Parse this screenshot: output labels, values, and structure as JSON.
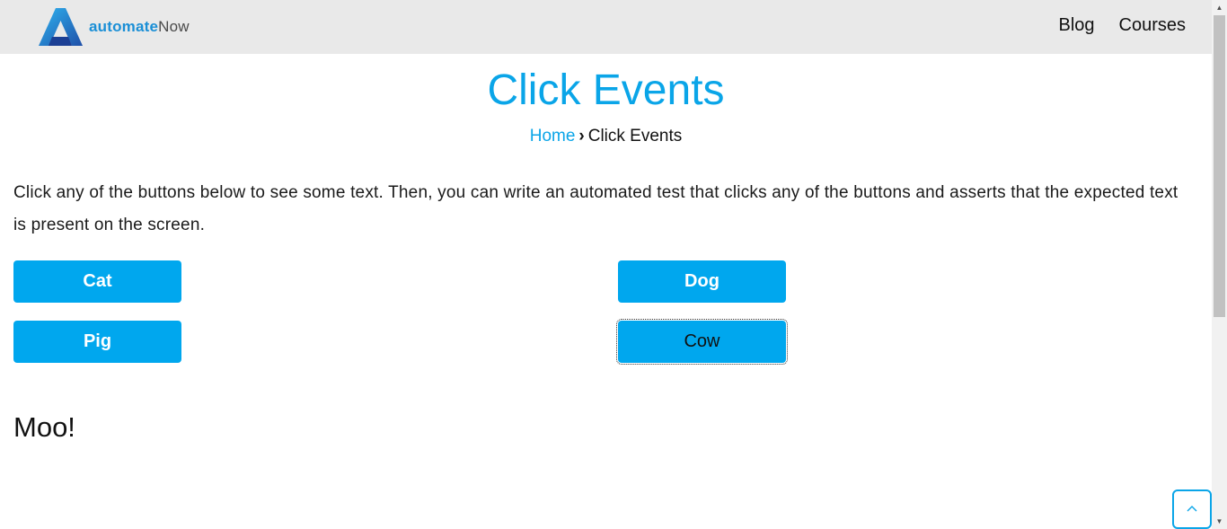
{
  "header": {
    "logo_text_bold": "automate",
    "logo_text_light": "Now",
    "nav": [
      {
        "label": "Blog"
      },
      {
        "label": "Courses"
      }
    ]
  },
  "main": {
    "title": "Click Events",
    "breadcrumb": {
      "home_label": "Home",
      "separator": "›",
      "current": "Click Events"
    },
    "intro": "Click any of the buttons below to see some text. Then, you can write an automated test that clicks any of the buttons and asserts that the expected text is present on the screen.",
    "buttons": {
      "cat": "Cat",
      "dog": "Dog",
      "pig": "Pig",
      "cow": "Cow"
    },
    "focused_button": "Cow",
    "result_text": "Moo!"
  },
  "scroll_to_top": {
    "icon": "chevron-up-icon",
    "glyph": "^"
  },
  "colors": {
    "accent": "#0aa5e8",
    "button_bg": "#00a7ee",
    "header_bg": "#e9e9e9"
  }
}
